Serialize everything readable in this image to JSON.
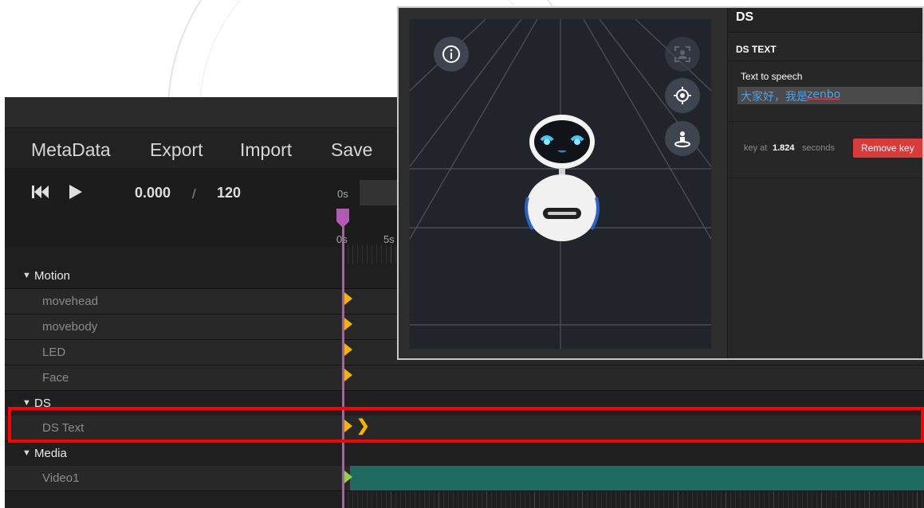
{
  "menu": {
    "items": [
      "MetaData",
      "Export",
      "Import",
      "Save"
    ]
  },
  "transport": {
    "current_time": "0.000",
    "separator": "/",
    "total": "120"
  },
  "ruler": {
    "top_label": "0s",
    "labels": [
      "0s",
      "5s"
    ]
  },
  "tracks": {
    "motion_group": "Motion",
    "movehead": "movehead",
    "movebody": "movebody",
    "led": "LED",
    "face": "Face",
    "ds_group": "DS",
    "ds_text": "DS Text",
    "media_group": "Media",
    "video1": "Video1"
  },
  "panel": {
    "title": "DS",
    "section": "DS TEXT",
    "tts_label": "Text to speech",
    "tts_value_prefix": "大家好，我是",
    "tts_value_word": "zenbo",
    "key_prefix": "key at",
    "key_time": "1.824",
    "key_suffix": "seconds",
    "remove_button": "Remove key"
  },
  "icons": {
    "info": "info-icon",
    "person_focus": "person-focus-icon",
    "target": "target-icon",
    "person_pin": "person-pin-icon",
    "skip_start": "skip-to-start-icon",
    "play": "play-icon",
    "collapse": "caret-down-icon"
  },
  "colors": {
    "playhead": "#b05ab0",
    "keyframe": "#f4b400",
    "media_keyframe": "#8fd14f",
    "video_bar": "#1f6a61",
    "remove_button": "#d93a3a",
    "highlight": "#ff0000",
    "tts_text": "#4ea1e8"
  }
}
